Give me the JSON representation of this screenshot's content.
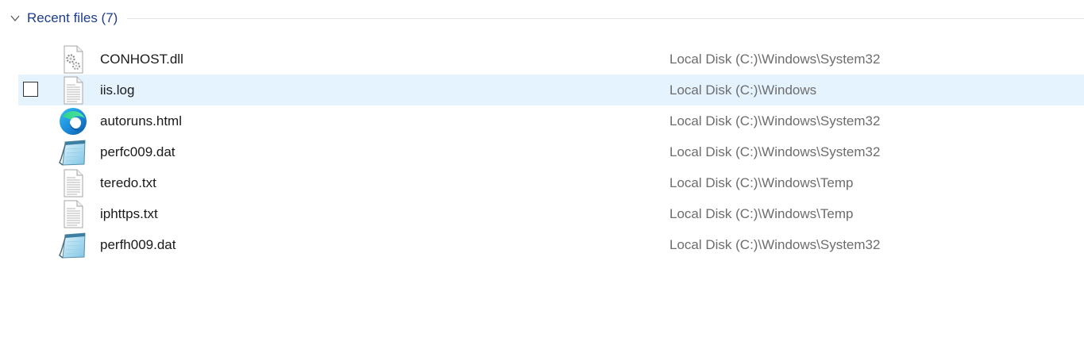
{
  "group": {
    "title": "Recent files (7)",
    "expanded": true,
    "icon": "chevron-down-icon"
  },
  "accent_color": "#1e3c8c",
  "hover_row_color": "#e5f3ff",
  "files": [
    {
      "name": "CONHOST.dll",
      "location": "Local Disk (C:)\\Windows\\System32",
      "icon": "dll-gear-file-icon"
    },
    {
      "name": "iis.log",
      "location": "Local Disk (C:)\\Windows",
      "icon": "text-file-icon",
      "hovered": true,
      "checked": false
    },
    {
      "name": "autoruns.html",
      "location": "Local Disk (C:)\\Windows\\System32",
      "icon": "edge-browser-icon"
    },
    {
      "name": "perfc009.dat",
      "location": "Local Disk (C:)\\Windows\\System32",
      "icon": "notepad-icon"
    },
    {
      "name": "teredo.txt",
      "location": "Local Disk (C:)\\Windows\\Temp",
      "icon": "text-file-icon"
    },
    {
      "name": "iphttps.txt",
      "location": "Local Disk (C:)\\Windows\\Temp",
      "icon": "text-file-icon"
    },
    {
      "name": "perfh009.dat",
      "location": "Local Disk (C:)\\Windows\\System32",
      "icon": "notepad-icon"
    }
  ]
}
